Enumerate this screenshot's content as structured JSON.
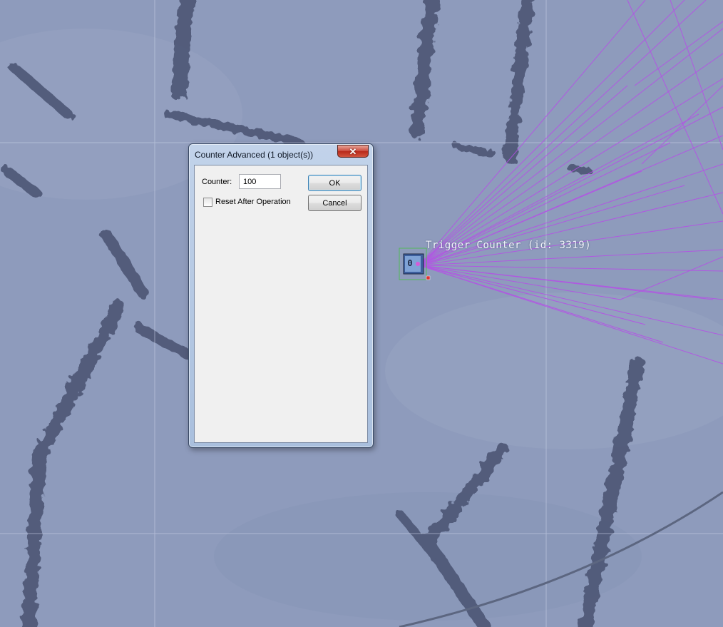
{
  "dialog": {
    "title": "Counter Advanced (1 object(s))",
    "close_glyph": "✕",
    "counter_label": "Counter:",
    "counter_value": "100",
    "reset_checked": false,
    "reset_label": "Reset After Operation",
    "ok_label": "OK",
    "cancel_label": "Cancel"
  },
  "map": {
    "object_label": "Trigger Counter (id: 3319)",
    "counter_value": "0",
    "colors": {
      "terrain": "#8e9bbc",
      "vegetation": "#4d5675",
      "grid": "#c7d0e6",
      "link_lines": "#b64de8",
      "selection": "#52b95a"
    }
  }
}
